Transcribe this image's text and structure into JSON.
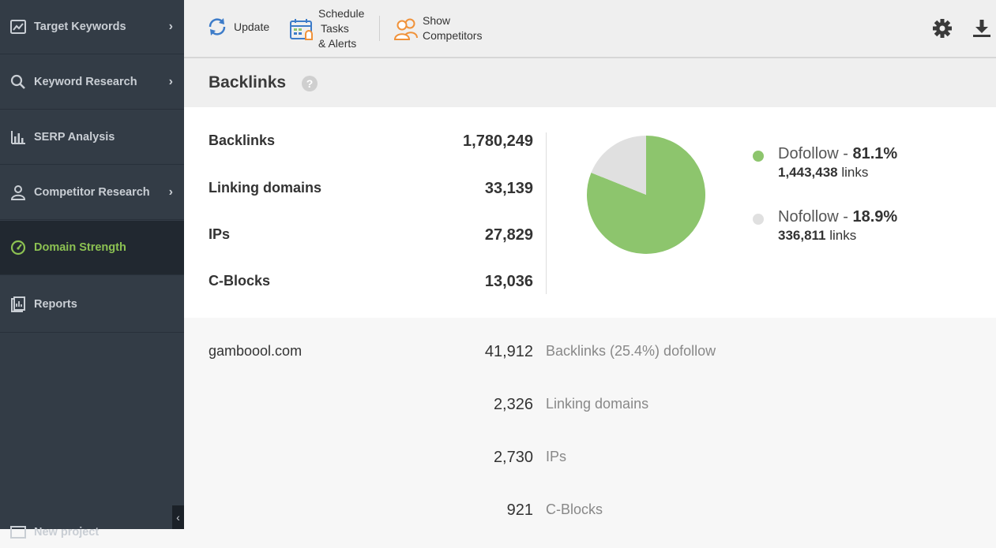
{
  "sidebar": {
    "items": [
      {
        "label": "Target Keywords",
        "icon": "chart-line-icon",
        "has_chevron": true
      },
      {
        "label": "Keyword Research",
        "icon": "search-icon",
        "has_chevron": true
      },
      {
        "label": "SERP Analysis",
        "icon": "bar-chart-icon",
        "has_chevron": false
      },
      {
        "label": "Competitor Research",
        "icon": "user-icon",
        "has_chevron": true
      },
      {
        "label": "Domain Strength",
        "icon": "gauge-icon",
        "has_chevron": false,
        "active": true
      },
      {
        "label": "Reports",
        "icon": "reports-icon",
        "has_chevron": false
      }
    ],
    "bottom_label": "New project",
    "chevron": "›",
    "collapse": "‹"
  },
  "toolbar": {
    "update_label": "Update",
    "schedule_line1": "Schedule",
    "schedule_line2": "Tasks",
    "schedule_line3": "& Alerts",
    "competitors_line1": "Show",
    "competitors_line2": "Competitors"
  },
  "section": {
    "title": "Backlinks",
    "help": "?"
  },
  "summary": {
    "stats": [
      {
        "label": "Backlinks",
        "value": "1,780,249"
      },
      {
        "label": "Linking domains",
        "value": "33,139"
      },
      {
        "label": "IPs",
        "value": "27,829"
      },
      {
        "label": "C-Blocks",
        "value": "13,036"
      }
    ],
    "dofollow": {
      "name": "Dofollow",
      "sep": " - ",
      "percent": "81.1%",
      "fraction": 0.811,
      "count": "1,443,438",
      "unit": " links",
      "color": "#8dc56d"
    },
    "nofollow": {
      "name": "Nofollow",
      "sep": " - ",
      "percent": "18.9%",
      "fraction": 0.189,
      "count": "336,811",
      "unit": " links",
      "color": "#e0e0e0"
    }
  },
  "details": {
    "domain": "gamboool.com",
    "rows": [
      {
        "value": "41,912",
        "label": "Backlinks (25.4%) dofollow"
      },
      {
        "value": "2,326",
        "label": "Linking domains"
      },
      {
        "value": "2,730",
        "label": "IPs"
      },
      {
        "value": "921",
        "label": "C-Blocks"
      }
    ]
  },
  "colors": {
    "accent": "#8cc152",
    "sidebar_bg": "#333c46",
    "update_icon": "#3d7cc9",
    "competitors_icon": "#f0923a"
  }
}
